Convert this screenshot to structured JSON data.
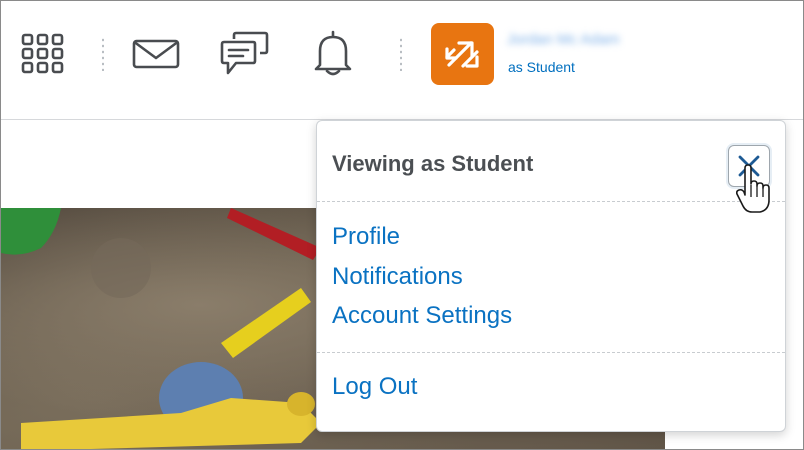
{
  "navbar": {
    "icons": [
      "apps-grid-icon",
      "mail-icon",
      "chat-icon",
      "bell-icon",
      "role-switch-icon"
    ],
    "username": "Jordan Mc Adam",
    "role_label": "as Student"
  },
  "dropdown": {
    "title": "Viewing as Student",
    "close_icon": "close-icon",
    "menu": [
      {
        "label": "Profile"
      },
      {
        "label": "Notifications"
      },
      {
        "label": "Account Settings"
      }
    ],
    "logout_label": "Log Out"
  },
  "colors": {
    "accent_orange": "#e87511",
    "link_blue": "#0a72c2",
    "role_blue": "#006fbf",
    "title_gray": "#4b4f53"
  }
}
